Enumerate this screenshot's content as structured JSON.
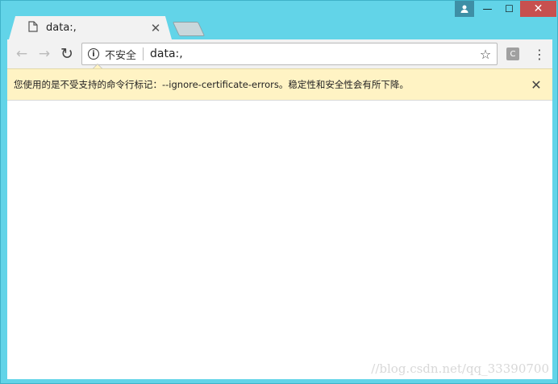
{
  "window": {
    "controls": {
      "minimize": "—",
      "maximize": "☐",
      "close": "✕"
    }
  },
  "tab": {
    "title": "data:,",
    "close": "✕"
  },
  "toolbar": {
    "back": "←",
    "forward": "→",
    "reload": "↻",
    "security_label": "不安全",
    "url": "data:,",
    "star": "☆",
    "extension_letter": "C",
    "menu": "⋮"
  },
  "infobar": {
    "message": "您使用的是不受支持的命令行标记：--ignore-certificate-errors。稳定性和安全性会有所下降。",
    "close": "✕"
  },
  "watermark": "//blog.csdn.net/qq_33390700",
  "colors": {
    "frame": "#62d4e8",
    "infobar_bg": "#fff3c4",
    "close_button": "#c7504f"
  }
}
